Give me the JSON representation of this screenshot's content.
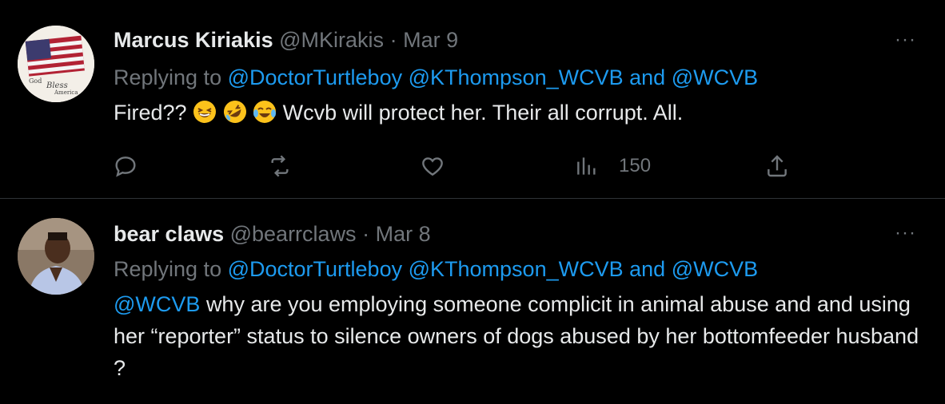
{
  "tweets": [
    {
      "name": "Marcus Kiriakis",
      "handle": "@MKirakis",
      "separator": "·",
      "date": "Mar 9",
      "replying_prefix": "Replying to",
      "mention1": "@DoctorTurtleboy",
      "mention2": "@KThompson_WCVB",
      "and_word": "and",
      "mention3": "@WCVB",
      "text_start": "Fired??",
      "text_end": "Wcvb will protect her. Their all corrupt. All.",
      "emojis": [
        "grinning-squinting-emoji",
        "rolling-on-floor-laughing-emoji",
        "face-with-tears-of-joy-emoji"
      ],
      "avatar_text": [
        "God",
        "Bless",
        "America"
      ],
      "views": "150",
      "more": "···"
    },
    {
      "name": "bear claws",
      "handle": "@bearrclaws",
      "separator": "·",
      "date": "Mar 8",
      "replying_prefix": "Replying to",
      "mention1": "@DoctorTurtleboy",
      "mention2": "@KThompson_WCVB",
      "and_word": "and",
      "mention3": "@WCVB",
      "body_mention": "@WCVB",
      "body_text": "why are you employing someone complicit in animal abuse and and using her “reporter” status to silence owners of dogs abused by her bottomfeeder husband ?",
      "more": "···"
    }
  ],
  "colors": {
    "link": "#1d9bf0",
    "muted": "#71767b",
    "text": "#e7e9ea",
    "divider": "#2f3336"
  }
}
